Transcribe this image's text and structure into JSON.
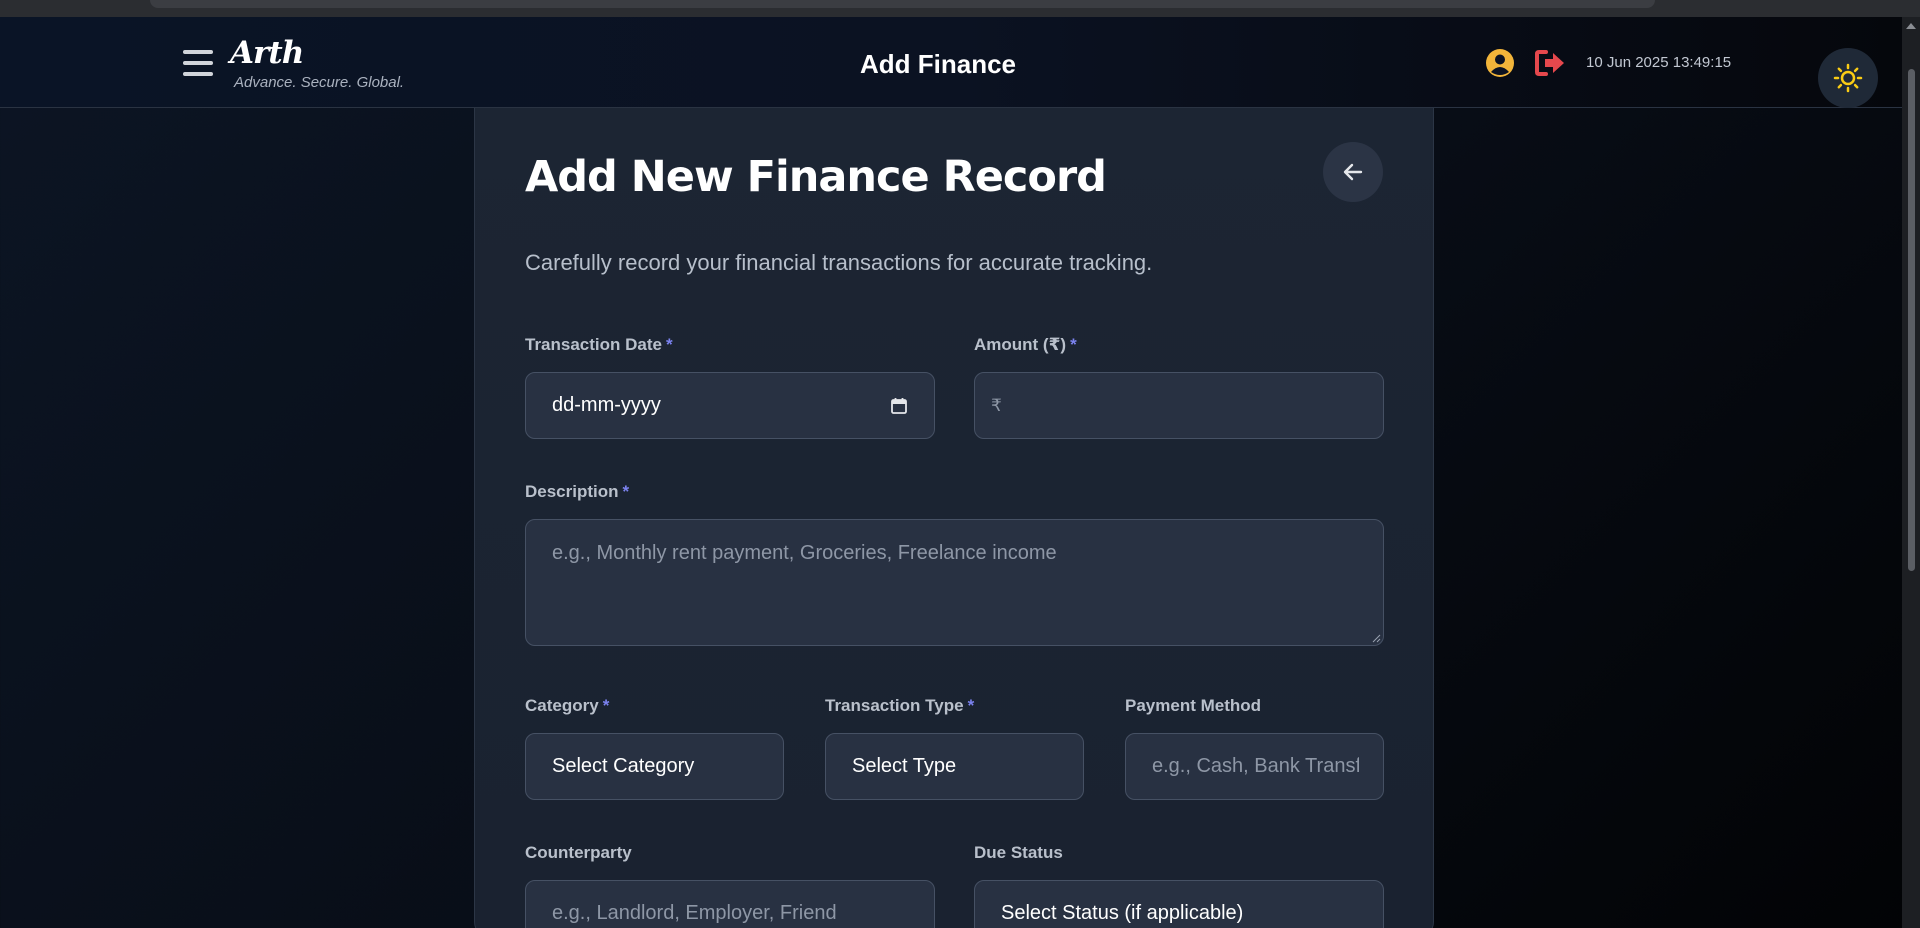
{
  "header": {
    "logo_text": "Arth",
    "tagline": "Advance. Secure. Global.",
    "title": "Add Finance",
    "datetime": "10 Jun 2025 13:49:15",
    "user_icon": "user-circle-icon",
    "logout_icon": "logout-icon",
    "theme_icon": "sun-icon",
    "menu_icon": "hamburger-menu-icon",
    "accent_user": "#f2b53a",
    "accent_logout": "#e5484d",
    "accent_sun": "#facc15"
  },
  "form": {
    "title": "Add New Finance Record",
    "subtitle": "Carefully record your financial transactions for accurate tracking.",
    "back_icon": "arrow-left-icon",
    "required_marker": "*",
    "transaction_date": {
      "label": "Transaction Date",
      "placeholder": "dd-mm-yyyy",
      "icon": "calendar-icon"
    },
    "amount": {
      "label": "Amount (₹)",
      "prefix": "₹",
      "value": ""
    },
    "description": {
      "label": "Description",
      "placeholder": "e.g., Monthly rent payment, Groceries, Freelance income"
    },
    "category": {
      "label": "Category",
      "selected": "Select Category"
    },
    "transaction_type": {
      "label": "Transaction Type",
      "selected": "Select Type"
    },
    "payment_method": {
      "label": "Payment Method",
      "placeholder": "e.g., Cash, Bank Transfer"
    },
    "counterparty": {
      "label": "Counterparty",
      "placeholder": "e.g., Landlord, Employer, Friend"
    },
    "due_status": {
      "label": "Due Status",
      "selected": "Select Status (if applicable)"
    }
  }
}
